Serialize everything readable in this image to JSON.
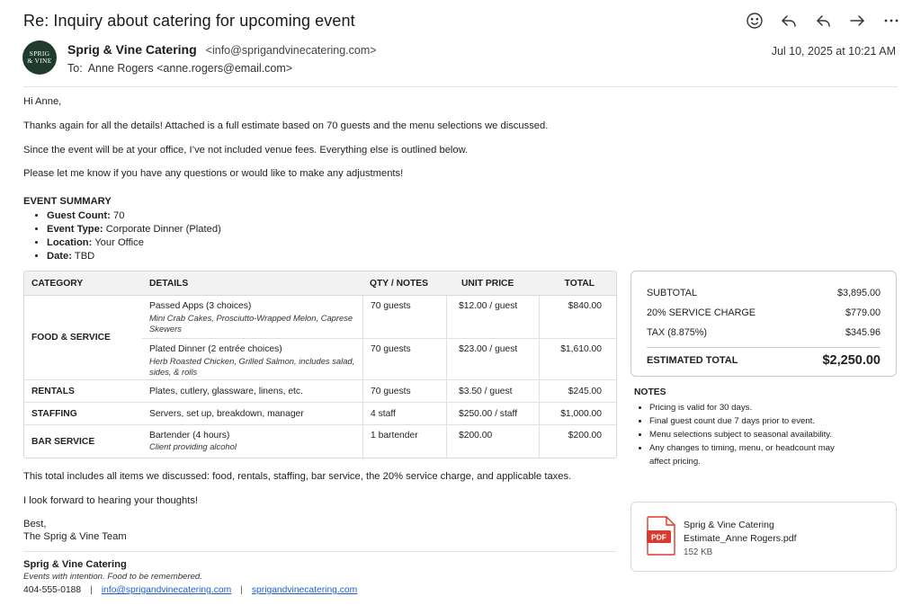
{
  "email": {
    "subject": "Re: Inquiry about catering for upcoming event",
    "sender_name": "Sprig & Vine Catering",
    "sender_email": "<info@sprigandvinecatering.com>",
    "avatar_line1": "SPRIG",
    "avatar_line2": "& VINE",
    "to_label": "To:",
    "to_value": "Anne Rogers <anne.rogers@email.com>",
    "date": "Jul 10, 2025 at 10:21 AM"
  },
  "toolbar": [
    "smiley-icon",
    "reply-icon",
    "reply-all-icon",
    "forward-icon",
    "more-icon"
  ],
  "body": {
    "greeting": "Hi Anne,",
    "p1": "Thanks again for all the details! Attached is a full estimate based on 70 guests and the menu selections we discussed.",
    "p2": "Since the event will be at your office, I’ve not included venue fees. Everything else is outlined below.",
    "p3": "Please let me know if you have any questions or would like to make any adjustments!",
    "closing_p1": "This total includes all items we discussed: food, rentals, staffing, bar service, the 20% service charge, and applicable taxes.",
    "closing_p2": "I look forward to hearing your thoughts!",
    "signoff": "Best,",
    "team": "The Sprig & Vine Team"
  },
  "summary": {
    "title": "EVENT SUMMARY",
    "items": [
      {
        "label": "Guest Count:",
        "value": "70"
      },
      {
        "label": "Event Type:",
        "value": "Corporate Dinner (Plated)"
      },
      {
        "label": "Location:",
        "value": "Your Office"
      },
      {
        "label": "Date:",
        "value": "TBD"
      }
    ]
  },
  "table": {
    "headers": [
      "CATEGORY",
      "DETAILS",
      "QTY / NOTES",
      "UNIT PRICE",
      "TOTAL"
    ],
    "food": {
      "category": "FOOD & SERVICE",
      "items": [
        {
          "title": "Passed Apps (3 choices)",
          "desc": "Mini Crab Cakes, Prosciutto-Wrapped Melon, Caprese Skewers",
          "qty": "70 guests",
          "unit": "$12.00 / guest",
          "total": "$840.00"
        },
        {
          "title": "Plated Dinner (2 entrée choices)",
          "desc": "Herb Roasted Chicken, Grilled Salmon, includes salad, sides, & rolls",
          "qty": "70 guests",
          "unit": "$23.00 / guest",
          "total": "$1,610.00"
        }
      ]
    },
    "rows": [
      {
        "category": "RENTALS",
        "detail": "Plates, cutlery, glassware, linens, etc.",
        "desc": "",
        "qty": "70 guests",
        "unit": "$3.50 / guest",
        "total": "$245.00"
      },
      {
        "category": "STAFFING",
        "detail": "Servers, set up, breakdown, manager",
        "desc": "",
        "qty": "4 staff",
        "unit": "$250.00 / staff",
        "total": "$1,000.00"
      },
      {
        "category": "BAR SERVICE",
        "detail": "Bartender (4 hours)",
        "desc": "Client providing alcohol",
        "qty": "1 bartender",
        "unit": "$200.00",
        "total": "$200.00"
      }
    ]
  },
  "totals": {
    "subtotal_label": "SUBTOTAL",
    "subtotal": "$3,895.00",
    "service_label": "20% SERVICE CHARGE",
    "service": "$779.00",
    "tax_label": "TAX (8.875%)",
    "tax": "$345.96",
    "total_label": "ESTIMATED TOTAL",
    "total": "$2,250.00"
  },
  "notes": {
    "title": "NOTES",
    "items": [
      "Pricing is valid for 30 days.",
      "Final guest count due 7 days prior to event.",
      "Menu selections subject to seasonal availability.",
      "Any changes to timing, menu, or headcount may affect pricing."
    ]
  },
  "attachment": {
    "icon_label": "PDF",
    "company": "Sprig & Vine Catering",
    "filename": "Estimate_Anne Rogers.pdf",
    "size": "152 KB"
  },
  "signature": {
    "name": "Sprig & Vine Catering",
    "tagline": "Events with intention. Food to be remembered.",
    "phone": "404-555-0188",
    "separator": "|",
    "email": "info@sprigandvinecatering.com",
    "website": "sprigandvinecatering.com"
  }
}
